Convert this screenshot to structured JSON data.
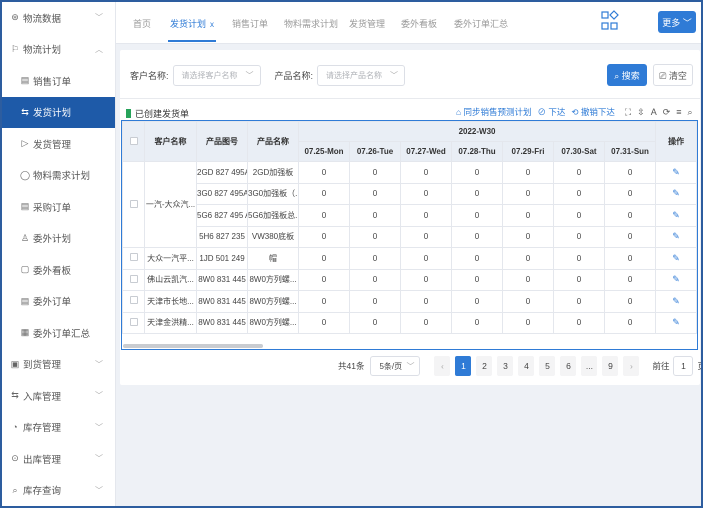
{
  "sidebar": {
    "items": [
      {
        "label": "物流数据",
        "icon": "dashboard-icon",
        "glyph": "⊛",
        "chevron": "﹀",
        "level": 0
      },
      {
        "label": "物流计划",
        "icon": "flag-icon",
        "glyph": "⚐",
        "chevron": "︿",
        "level": 0
      },
      {
        "label": "销售订单",
        "icon": "order-icon",
        "glyph": "▤",
        "chevron": "",
        "level": 1
      },
      {
        "label": "发货计划",
        "icon": "ship-plan-icon",
        "glyph": "⇆",
        "chevron": "",
        "level": 1,
        "active": true
      },
      {
        "label": "发货管理",
        "icon": "send-icon",
        "glyph": "▷",
        "chevron": "",
        "level": 1
      },
      {
        "label": "物料需求计划",
        "icon": "material-icon",
        "glyph": "◯",
        "chevron": "",
        "level": 1
      },
      {
        "label": "采购订单",
        "icon": "purchase-icon",
        "glyph": "▤",
        "chevron": "",
        "level": 1
      },
      {
        "label": "委外计划",
        "icon": "outsource-plan-icon",
        "glyph": "♙",
        "chevron": "",
        "level": 1
      },
      {
        "label": "委外看板",
        "icon": "board-icon",
        "glyph": "▢",
        "chevron": "",
        "level": 1
      },
      {
        "label": "委外订单",
        "icon": "outsource-order-icon",
        "glyph": "▤",
        "chevron": "",
        "level": 1
      },
      {
        "label": "委外订单汇总",
        "icon": "summary-icon",
        "glyph": "▦",
        "chevron": "",
        "level": 1
      },
      {
        "label": "到货管理",
        "icon": "arrival-icon",
        "glyph": "▣",
        "chevron": "﹀",
        "level": 0
      },
      {
        "label": "入库管理",
        "icon": "inbound-icon",
        "glyph": "⇆",
        "chevron": "﹀",
        "level": 0
      },
      {
        "label": "库存管理",
        "icon": "stock-icon",
        "glyph": "◔",
        "chevron": "﹀",
        "level": 0
      },
      {
        "label": "出库管理",
        "icon": "outbound-icon",
        "glyph": "⊙",
        "chevron": "﹀",
        "level": 0
      },
      {
        "label": "库存查询",
        "icon": "search-icon",
        "glyph": "⌕",
        "chevron": "﹀",
        "level": 0
      }
    ]
  },
  "topbar": {
    "tabs": [
      "首页",
      "发货计划",
      "销售订单",
      "物料需求计划",
      "发货管理",
      "委外看板",
      "委外订单汇总"
    ],
    "close_glyph": "x",
    "more_label": "更多 ﹀"
  },
  "search": {
    "customer_label": "客户名称:",
    "customer_placeholder": "请选择客户名称",
    "product_label": "产品名称:",
    "product_placeholder": "请选择产品名称",
    "search_label": "⌕ 搜索",
    "clear_label": "⎚ 清空"
  },
  "toolbar": {
    "title": "已创建发货单",
    "sync_label": "⌂ 同步销售预测计划",
    "issue_label": "⊘ 下达",
    "revoke_label": "⟲ 撤销下达",
    "tool_glyphs": [
      "⛶",
      "⇳",
      "A",
      "⟳",
      "≡",
      "⌕"
    ]
  },
  "table": {
    "headers": {
      "customer": "客户名称",
      "part_no": "产品图号",
      "product": "产品名称",
      "week": "2022-W30",
      "op": "操作"
    },
    "days": [
      "07.25-Mon",
      "07.26-Tue",
      "07.27-Wed",
      "07.28-Thu",
      "07.29-Fri",
      "07.30-Sat",
      "07.31-Sun"
    ],
    "rows": [
      {
        "customer": "一汽-大众汽...",
        "part_no": "2GD 827 495A",
        "product": "2GD加强板",
        "vals": [
          "0",
          "0",
          "0",
          "0",
          "0",
          "0",
          "0"
        ]
      },
      {
        "part_no": "3G0 827 495A",
        "product": "3G0加强板（...",
        "vals": [
          "0",
          "0",
          "0",
          "0",
          "0",
          "0",
          "0"
        ]
      },
      {
        "part_no": "5G6 827 495 A",
        "product": "5G6加强板总...",
        "vals": [
          "0",
          "0",
          "0",
          "0",
          "0",
          "0",
          "0"
        ]
      },
      {
        "part_no": "5H6 827 235",
        "product": "VW380底板",
        "vals": [
          "0",
          "0",
          "0",
          "0",
          "0",
          "0",
          "0"
        ]
      },
      {
        "customer": "大众一汽平...",
        "part_no": "1JD 501 249",
        "product": "帽",
        "vals": [
          "0",
          "0",
          "0",
          "0",
          "0",
          "0",
          "0"
        ]
      },
      {
        "customer": "佛山云凯汽...",
        "part_no": "8W0 831 445",
        "product": "8W0方列螺...",
        "vals": [
          "0",
          "0",
          "0",
          "0",
          "0",
          "0",
          "0"
        ]
      },
      {
        "customer": "天津市长地...",
        "part_no": "8W0 831 445",
        "product": "8W0方列螺...",
        "vals": [
          "0",
          "0",
          "0",
          "0",
          "0",
          "0",
          "0"
        ]
      },
      {
        "customer": "天津金洪精...",
        "part_no": "8W0 831 445",
        "product": "8W0方列螺...",
        "vals": [
          "0",
          "0",
          "0",
          "0",
          "0",
          "0",
          "0"
        ]
      }
    ]
  },
  "pagination": {
    "total": "共41条",
    "page_size": "5条/页",
    "pages": [
      "1",
      "2",
      "3",
      "4",
      "5",
      "6",
      "...",
      "9"
    ],
    "current": "1",
    "goto_label": "前往",
    "goto_value": "1",
    "page_suffix": "页"
  },
  "colors": {
    "accent": "#2f7bd6",
    "sidebar_active": "#1e5aa8",
    "created_marker": "#27a35a"
  }
}
